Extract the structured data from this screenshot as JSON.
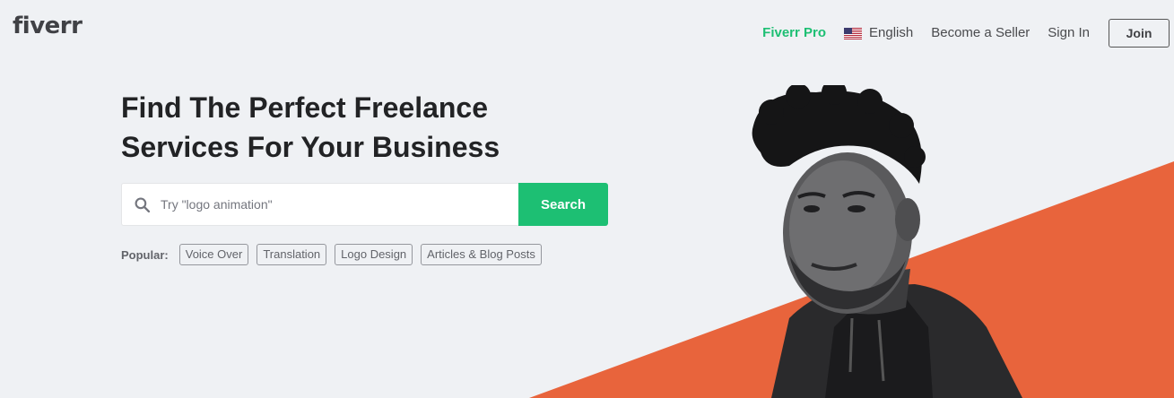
{
  "header": {
    "logo": "fiverr",
    "nav": {
      "pro": "Fiverr Pro",
      "language": "English",
      "become_seller": "Become a Seller",
      "sign_in": "Sign In",
      "join": "Join"
    }
  },
  "hero": {
    "title": "Find The Perfect Freelance Services For Your Business",
    "search": {
      "placeholder": "Try \"logo animation\"",
      "value": "",
      "button": "Search"
    },
    "popular": {
      "label": "Popular:",
      "tags": [
        "Voice Over",
        "Translation",
        "Logo Design",
        "Articles & Blog Posts"
      ]
    }
  },
  "colors": {
    "brand_green": "#1dbf73",
    "accent_orange": "#e8643c",
    "background": "#eff1f4"
  },
  "icons": [
    "search-icon",
    "us-flag-icon"
  ]
}
